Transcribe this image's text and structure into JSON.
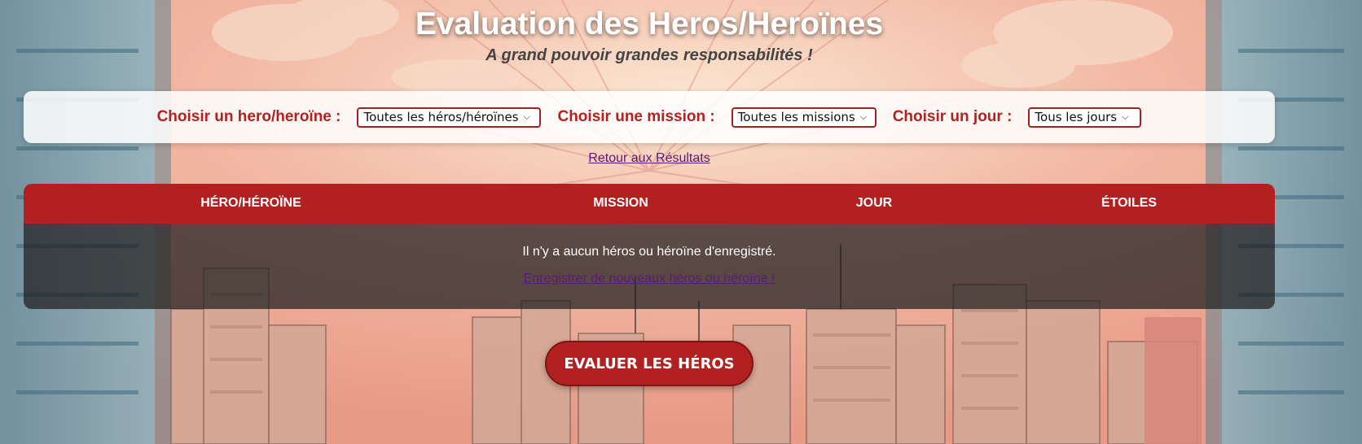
{
  "header": {
    "title": "Evaluation des Heros/Heroïnes",
    "subtitle": "A grand pouvoir grandes responsabilités !"
  },
  "filters": [
    {
      "label": "Choisir un hero/heroïne :",
      "selected": "Toutes les héros/héroïnes"
    },
    {
      "label": "Choisir une mission :",
      "selected": "Toutes les missions"
    },
    {
      "label": "Choisir un jour :",
      "selected": "Tous les jours"
    }
  ],
  "back_link": "Retour aux Résultats",
  "table": {
    "columns": [
      "HÉRO/HÉROÏNE",
      "MISSION",
      "JOUR",
      "ÉTOILES"
    ],
    "empty_message": "Il n'y a aucun héros ou héroïne d'enregistré.",
    "register_link": "Enregistrer de nouveaux héros ou héroïne !"
  },
  "cta": {
    "label": "EVALUER LES HÉROS"
  },
  "colors": {
    "accent": "#b22020",
    "label_red": "#b22222",
    "link": "#5b1a7a",
    "table_body": "#1e1e1e"
  },
  "icons": {
    "select_arrow": "chevron-down-icon"
  }
}
